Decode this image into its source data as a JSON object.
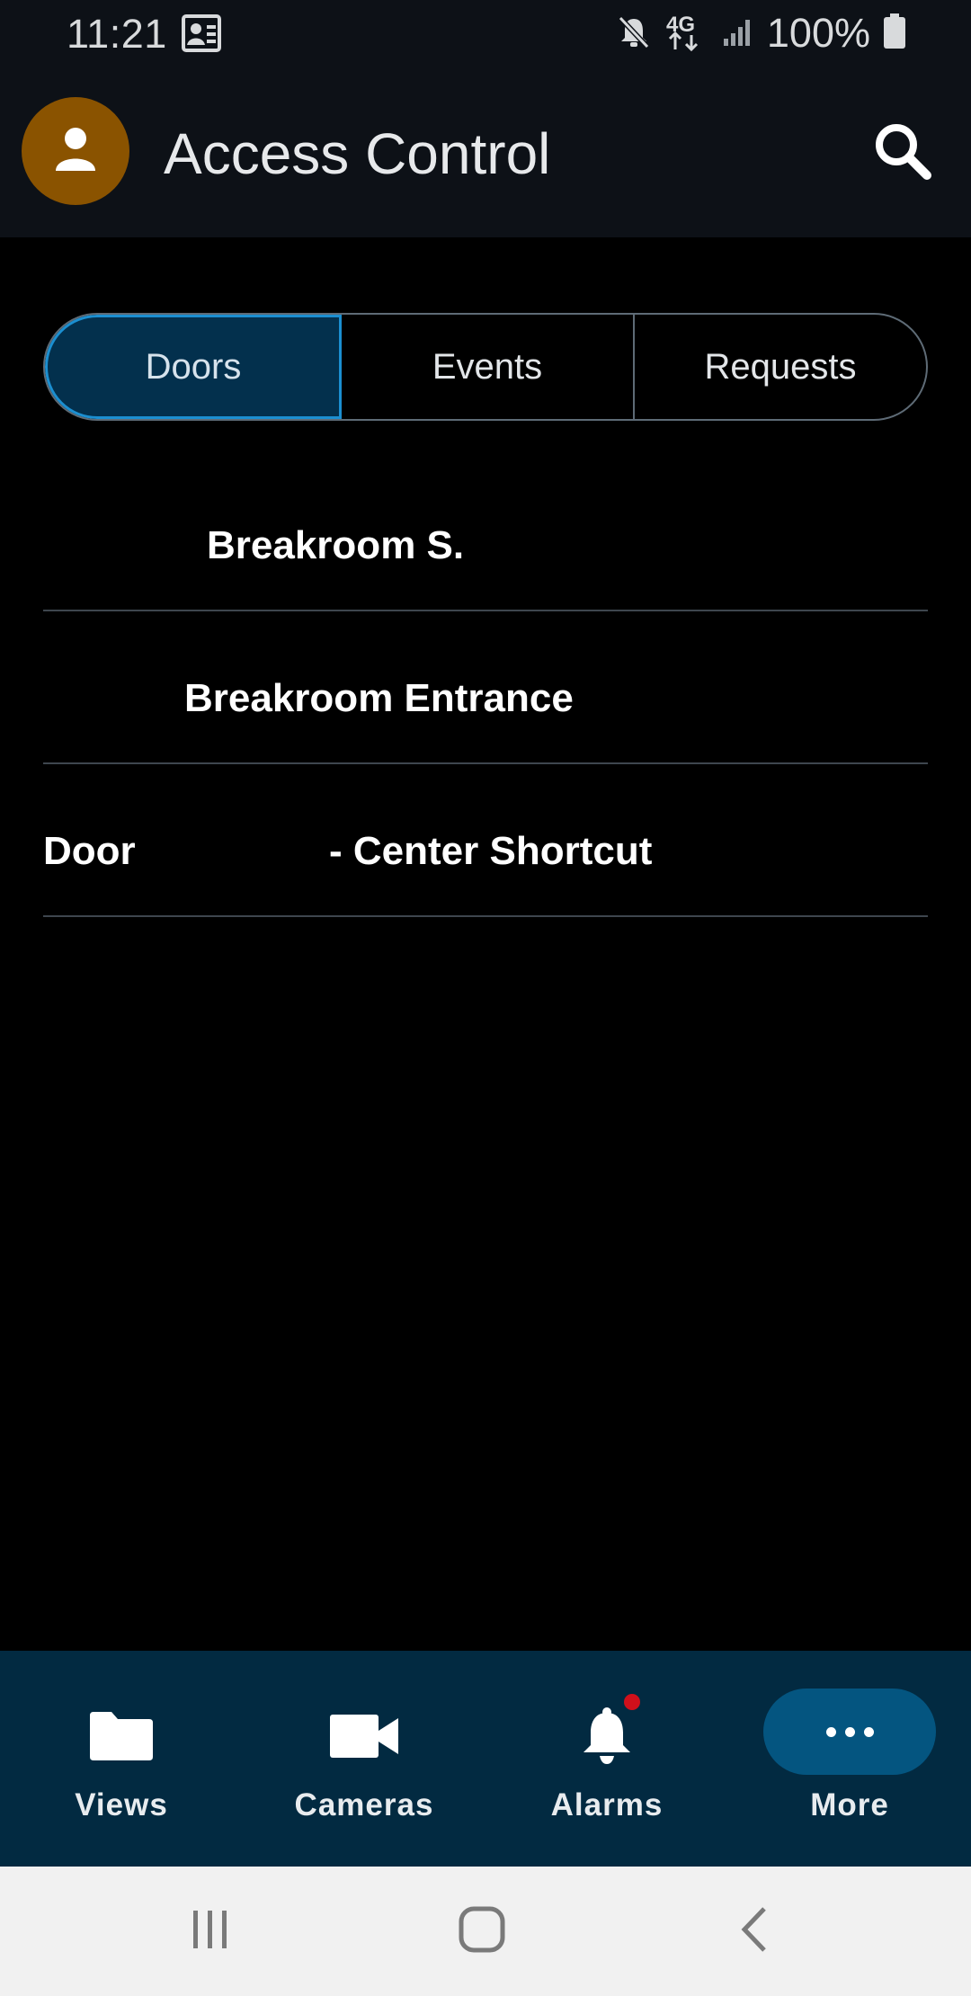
{
  "status_bar": {
    "time": "11:21",
    "network": "4G",
    "battery": "100%"
  },
  "app_bar": {
    "title": "Access Control",
    "avatar_icon": "person-icon",
    "search_icon": "search-icon",
    "avatar_color": "#8a5300"
  },
  "tabs": [
    {
      "label": "Doors",
      "active": true
    },
    {
      "label": "Events",
      "active": false
    },
    {
      "label": "Requests",
      "active": false
    }
  ],
  "doors": [
    {
      "label": "Breakroom S."
    },
    {
      "label": "Breakroom Entrance"
    },
    {
      "label": "Door",
      "label_suffix": "- Center Shortcut"
    }
  ],
  "bottom_nav": [
    {
      "label": "Views",
      "icon": "folder-icon"
    },
    {
      "label": "Cameras",
      "icon": "video-camera-icon"
    },
    {
      "label": "Alarms",
      "icon": "bell-icon",
      "badge": true
    },
    {
      "label": "More",
      "icon": "more-icon",
      "active": true
    }
  ],
  "colors": {
    "accent": "#1b8fd1",
    "nav_background": "#022a41",
    "active_pill": "#045580",
    "alarm_badge": "#d0101b"
  }
}
